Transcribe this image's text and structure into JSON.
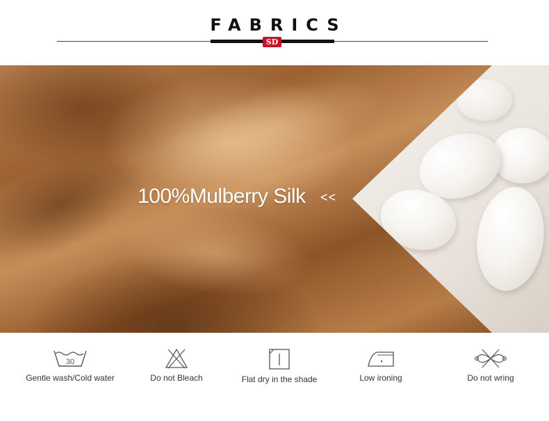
{
  "header": {
    "title": "FABRICS",
    "logo_text": "SD"
  },
  "hero": {
    "headline": "100%Mulberry Silk",
    "arrows": "<<"
  },
  "care": {
    "items": [
      {
        "label": "Gentle wash/Cold water",
        "icon": "wash-30-icon",
        "temp": "30"
      },
      {
        "label": "Do not Bleach",
        "icon": "no-bleach-icon"
      },
      {
        "label": "Flat dry in the shade",
        "icon": "dry-flat-shade-icon"
      },
      {
        "label": "Low ironing",
        "icon": "iron-low-icon"
      },
      {
        "label": "Do not wring",
        "icon": "no-wring-icon"
      }
    ]
  },
  "colors": {
    "text": "#111111",
    "accent": "#c9102a",
    "silk": "#a96d3d"
  }
}
